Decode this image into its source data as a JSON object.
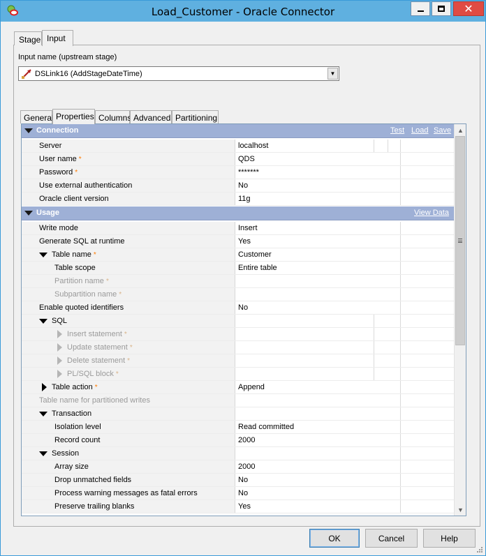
{
  "window": {
    "title": "Load_Customer - Oracle Connector"
  },
  "top_tabs": [
    "Stage",
    "Input"
  ],
  "input_name": {
    "label": "Input name (upstream stage)",
    "value": "DSLink16 (AddStageDateTime)"
  },
  "inner_tabs": [
    "General",
    "Properties",
    "Columns",
    "Advanced",
    "Partitioning"
  ],
  "connection": {
    "title": "Connection",
    "links": [
      "Test",
      "Load",
      "Save"
    ],
    "rows": [
      {
        "name": "Server",
        "value": "localhost"
      },
      {
        "name": "User name",
        "value": "QDS",
        "required": true
      },
      {
        "name": "Password",
        "value": "*******",
        "required": true
      },
      {
        "name": "Use external authentication",
        "value": "No"
      },
      {
        "name": "Oracle client version",
        "value": "11g"
      }
    ]
  },
  "usage": {
    "title": "Usage",
    "link": "View Data",
    "rows": [
      {
        "name": "Write mode",
        "value": "Insert"
      },
      {
        "name": "Generate SQL at runtime",
        "value": "Yes"
      },
      {
        "name": "Table name",
        "value": "Customer",
        "required": true
      },
      {
        "name": "Table scope",
        "value": "Entire table"
      },
      {
        "name": "Partition name",
        "value": "",
        "required": true,
        "disabled": true
      },
      {
        "name": "Subpartition name",
        "value": "",
        "required": true,
        "disabled": true
      },
      {
        "name": "Enable quoted identifiers",
        "value": "No"
      },
      {
        "name": "SQL",
        "value": ""
      },
      {
        "name": "Insert statement",
        "value": "",
        "required": true,
        "disabled": true
      },
      {
        "name": "Update statement",
        "value": "",
        "required": true,
        "disabled": true
      },
      {
        "name": "Delete statement",
        "value": "",
        "required": true,
        "disabled": true
      },
      {
        "name": "PL/SQL block",
        "value": "",
        "required": true,
        "disabled": true
      },
      {
        "name": "Table action",
        "value": "Append",
        "required": true
      },
      {
        "name": "Table name for partitioned writes",
        "value": "",
        "disabled": true
      },
      {
        "name": "Transaction",
        "value": ""
      },
      {
        "name": "Isolation level",
        "value": "Read committed"
      },
      {
        "name": "Record count",
        "value": "2000"
      },
      {
        "name": "Session",
        "value": ""
      },
      {
        "name": "Array size",
        "value": "2000"
      },
      {
        "name": "Drop unmatched fields",
        "value": "No"
      },
      {
        "name": "Process warning messages as fatal errors",
        "value": "No"
      },
      {
        "name": "Preserve trailing blanks",
        "value": "Yes"
      }
    ]
  },
  "buttons": {
    "ok": "OK",
    "cancel": "Cancel",
    "help": "Help"
  },
  "colors": {
    "section_header": "#9eb0d6",
    "required_marker": "#ff7b00",
    "titlebar": "#5fb0e0"
  }
}
